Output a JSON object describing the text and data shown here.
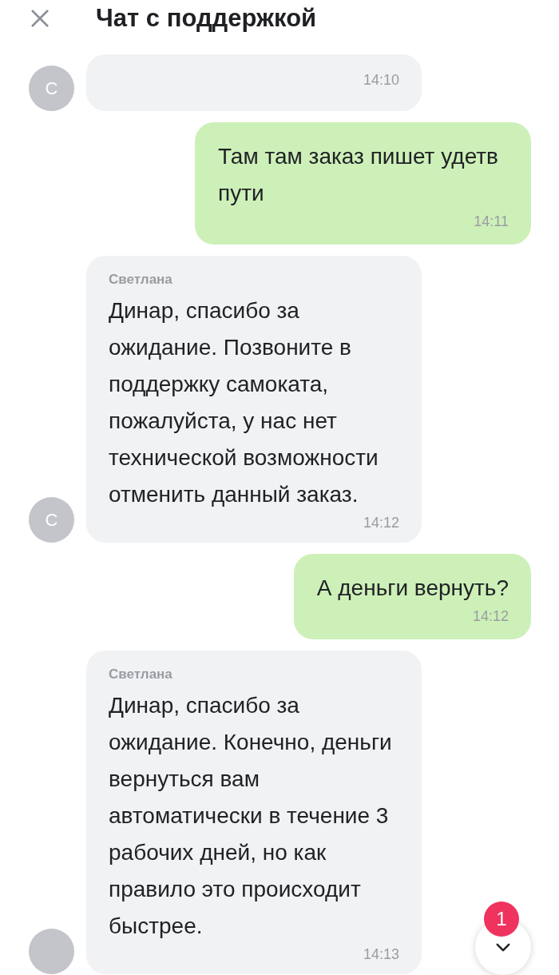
{
  "header": {
    "title": "Чат с поддержкой"
  },
  "messages": [
    {
      "kind": "incoming",
      "avatar": "С",
      "time": "14:10"
    },
    {
      "kind": "outgoing",
      "text": "Там там заказ пишет удетв пути",
      "time": "14:11"
    },
    {
      "kind": "incoming",
      "avatar": "С",
      "sender": "Светлана",
      "text": "Динар, спасибо за ожидание. Позвоните в поддержку самоката, пожалуйста, у нас нет технической возможности отменить данный заказ.",
      "time": "14:12"
    },
    {
      "kind": "outgoing",
      "text": "А деньги вернуть?",
      "time": "14:12"
    },
    {
      "kind": "incoming",
      "sender": "Светлана",
      "text": "Динар, спасибо за ожидание. Конечно, деньги вернуться вам автоматически в течение 3 рабочих дней, но как правило это происходит быстрее.",
      "time": "14:13"
    }
  ],
  "scroll_button": {
    "badge": "1"
  }
}
